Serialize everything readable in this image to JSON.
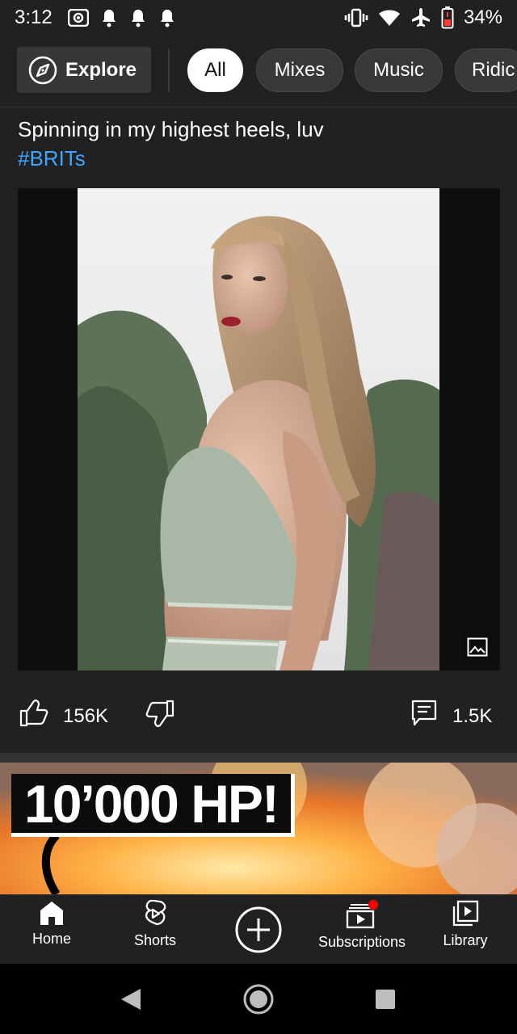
{
  "status_bar": {
    "time": "3:12",
    "battery": "34%",
    "left_icons": [
      "screen-record-icon",
      "notification-bell-icon",
      "notification-bell-icon",
      "notification-bell-icon"
    ],
    "right_icons": [
      "vibrate-icon",
      "wifi-icon",
      "airplane-mode-icon",
      "battery-low-icon"
    ]
  },
  "chips": {
    "explore": "Explore",
    "items": [
      "All",
      "Mixes",
      "Music",
      "Ridic"
    ],
    "active": "All"
  },
  "post": {
    "text": "Spinning in my highest heels, luv",
    "hashtag": "#BRITs",
    "likes": "156K",
    "comments": "1.5K"
  },
  "next_video": {
    "thumbnail_text": "10’000 HP!"
  },
  "bottom_nav": {
    "home": "Home",
    "shorts": "Shorts",
    "subscriptions": "Subscriptions",
    "library": "Library"
  },
  "colors": {
    "background": "#212121",
    "accent_link": "#3ea6ff",
    "notification_dot": "#ff0000"
  }
}
